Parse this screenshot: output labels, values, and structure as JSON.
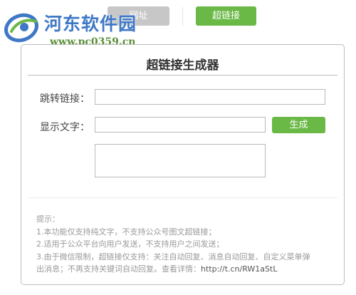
{
  "tabs": {
    "link_label": "网址",
    "hyperlink_label": "超链接"
  },
  "watermark": {
    "title": "河东软件园",
    "url": "www.pc0359.cn"
  },
  "panel": {
    "title": "超链接生成器",
    "jump_label": "跳转链接：",
    "jump_value": "",
    "text_label": "显示文字：",
    "text_value": "",
    "generate_label": "生成",
    "output_value": ""
  },
  "tips": {
    "heading": "提示：",
    "line1": "1.本功能仅支持纯文字，不支持公众号图文超链接；",
    "line2": "2.适用于公众平台向用户发送，不支持用户之间发送；",
    "line3": "3.由于微信限制，超链接仅支持：关注自动回复、消息自动回复、自定义菜单弹",
    "line4": "出消息；不再支持关键词自动回复。查看详情：",
    "link": "http://t.cn/RW1aStL"
  },
  "colors": {
    "accent_green": "#6ab845",
    "inactive_tab": "#c7c7c7",
    "watermark_blue": "#3f78c6"
  }
}
